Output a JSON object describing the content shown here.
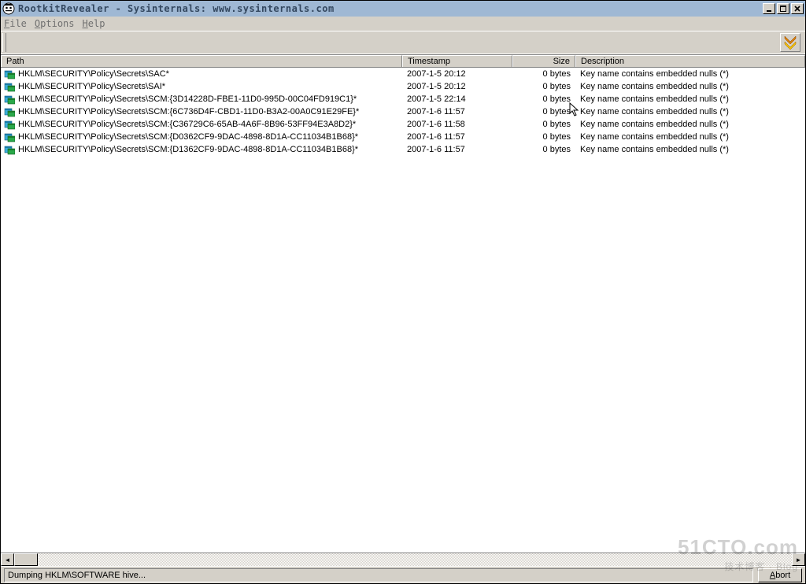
{
  "window": {
    "title": "RootkitRevealer - Sysinternals: www.sysinternals.com"
  },
  "menu": {
    "file": "File",
    "options": "Options",
    "help": "Help"
  },
  "columns": {
    "path": "Path",
    "timestamp": "Timestamp",
    "size": "Size",
    "description": "Description"
  },
  "rows": [
    {
      "path": "HKLM\\SECURITY\\Policy\\Secrets\\SAC*",
      "timestamp": "2007-1-5 20:12",
      "size": "0 bytes",
      "description": "Key name contains embedded nulls (*)"
    },
    {
      "path": "HKLM\\SECURITY\\Policy\\Secrets\\SAI*",
      "timestamp": "2007-1-5 20:12",
      "size": "0 bytes",
      "description": "Key name contains embedded nulls (*)"
    },
    {
      "path": "HKLM\\SECURITY\\Policy\\Secrets\\SCM:{3D14228D-FBE1-11D0-995D-00C04FD919C1}*",
      "timestamp": "2007-1-5 22:14",
      "size": "0 bytes",
      "description": "Key name contains embedded nulls (*)"
    },
    {
      "path": "HKLM\\SECURITY\\Policy\\Secrets\\SCM:{6C736D4F-CBD1-11D0-B3A2-00A0C91E29FE}*",
      "timestamp": "2007-1-6 11:57",
      "size": "0 bytes",
      "description": "Key name contains embedded nulls (*)"
    },
    {
      "path": "HKLM\\SECURITY\\Policy\\Secrets\\SCM:{C36729C6-65AB-4A6F-8B96-53FF94E3A8D2}*",
      "timestamp": "2007-1-6 11:58",
      "size": "0 bytes",
      "description": "Key name contains embedded nulls (*)"
    },
    {
      "path": "HKLM\\SECURITY\\Policy\\Secrets\\SCM:{D0362CF9-9DAC-4898-8D1A-CC11034B1B68}*",
      "timestamp": "2007-1-6 11:57",
      "size": "0 bytes",
      "description": "Key name contains embedded nulls (*)"
    },
    {
      "path": "HKLM\\SECURITY\\Policy\\Secrets\\SCM:{D1362CF9-9DAC-4898-8D1A-CC11034B1B68}*",
      "timestamp": "2007-1-6 11:57",
      "size": "0 bytes",
      "description": "Key name contains embedded nulls (*)"
    }
  ],
  "status": {
    "text": "Dumping HKLM\\SOFTWARE hive...",
    "abort": "Abort"
  },
  "watermark": {
    "big": "51CTO.com",
    "small": "技术博客 · Blog"
  }
}
